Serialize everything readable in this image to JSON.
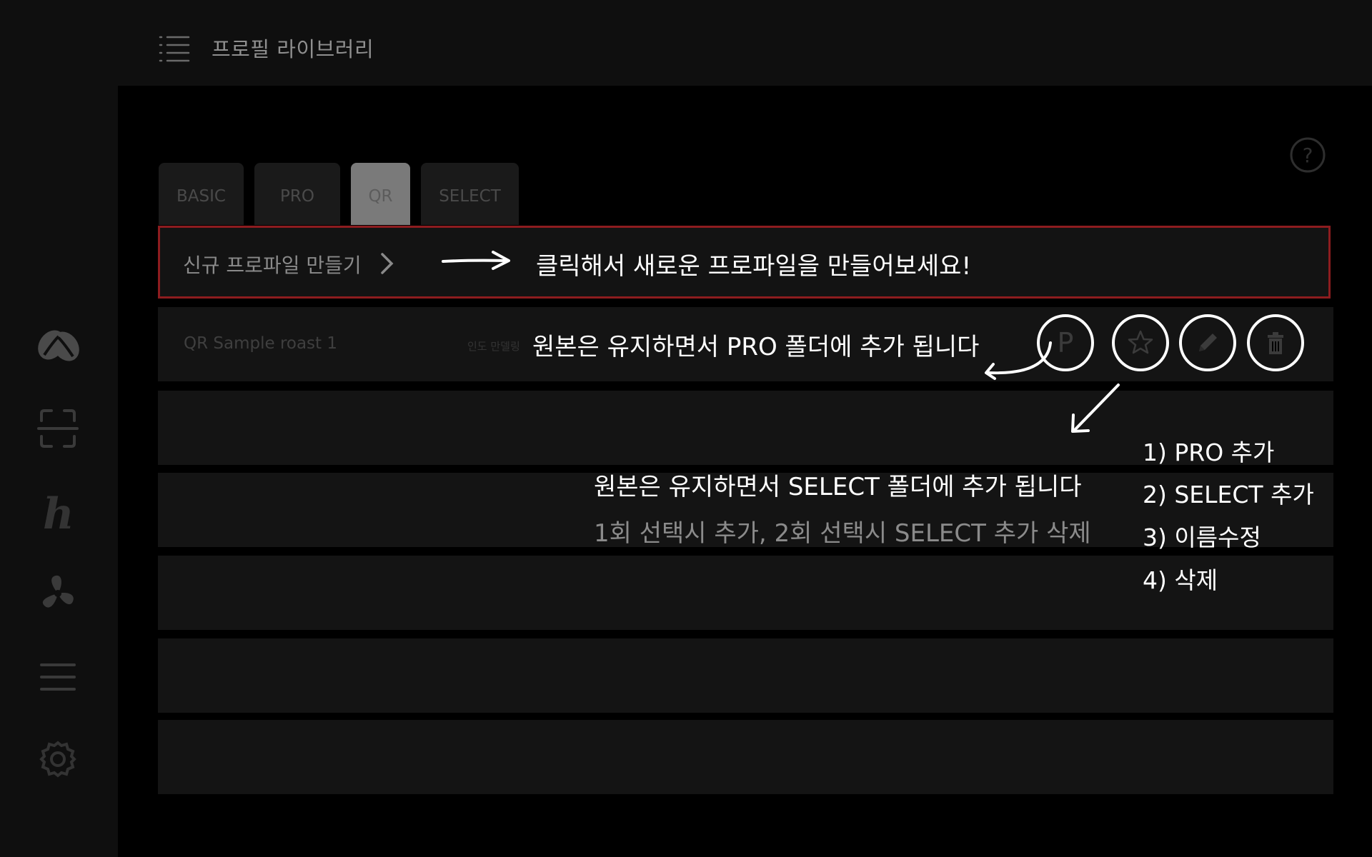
{
  "header": {
    "title": "프로필 라이브러리"
  },
  "sidebar": {
    "items": [
      {
        "icon": "coffee-bean-icon"
      },
      {
        "icon": "qr-scan-icon"
      },
      {
        "icon": "h-logo-icon"
      },
      {
        "icon": "fan-icon"
      },
      {
        "icon": "menu-lines-icon"
      },
      {
        "icon": "gear-icon"
      }
    ]
  },
  "tabs": [
    {
      "label": "BASIC"
    },
    {
      "label": "PRO"
    },
    {
      "label": "QR",
      "active": true
    },
    {
      "label": "SELECT"
    }
  ],
  "create_row": {
    "label": "신규 프로파일 만들기"
  },
  "profile_rows": [
    {
      "name": "QR Sample roast 1",
      "subtitle": "인도 만델링"
    }
  ],
  "overlay": {
    "create_hint": "클릭해서 새로운 프로파일을 만들어보세요!",
    "pro_hint": "원본은 유지하면서 PRO 폴더에 추가 됩니다",
    "select_hint": "원본은 유지하면서 SELECT 폴더에 추가 됩니다",
    "select_hint_sub": "1회 선택시 추가, 2회 선택시 SELECT 추가 삭제",
    "button_letter": "P",
    "list": [
      "1) PRO 추가",
      "2) SELECT 추가",
      "3) 이름수정",
      "4) 삭제"
    ]
  },
  "colors": {
    "background": "#000000",
    "panel": "#0f0f0f",
    "row": "#141414",
    "highlight_border": "#8d1c1f",
    "active_tab": "#7a7a7a"
  }
}
